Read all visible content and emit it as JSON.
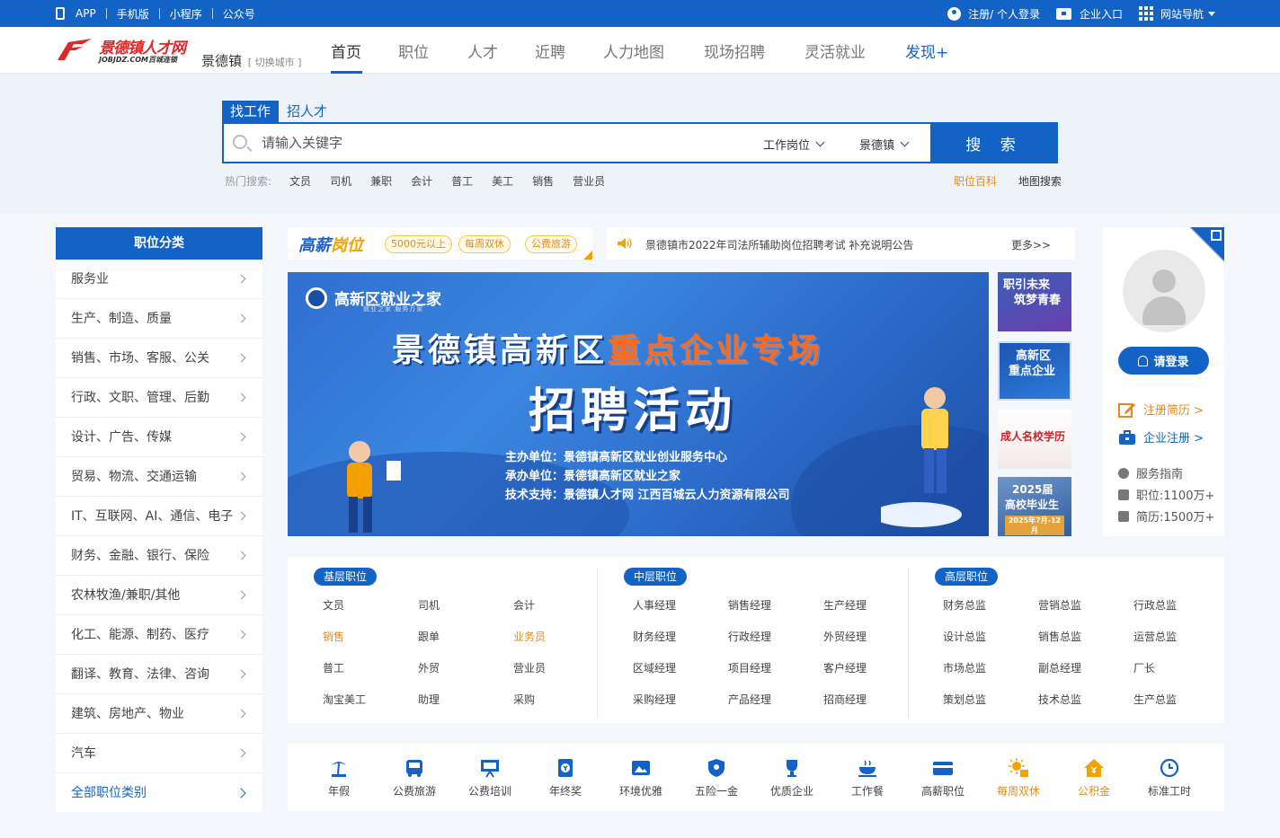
{
  "topbar": {
    "links": [
      "APP",
      "手机版",
      "小程序",
      "公众号"
    ],
    "login": "注册/ 个人登录",
    "enterprise": "企业入口",
    "site_nav": "网站导航"
  },
  "header": {
    "logo_name": "景德镇人才网",
    "logo_domain": "JOBJDZ.COM百城连锁",
    "city": "景德镇",
    "switch_city": "[ 切换城市 ]",
    "nav": [
      "首页",
      "职位",
      "人才",
      "近聘",
      "人力地图",
      "现场招聘",
      "灵活就业",
      "发现+"
    ]
  },
  "search": {
    "tabs": [
      "找工作",
      "招人才"
    ],
    "placeholder": "请输入关键字",
    "dd_position": "工作岗位",
    "dd_city": "景德镇",
    "button": "搜 索",
    "hot_label": "热门搜索:",
    "hot_keywords": [
      "文员",
      "司机",
      "兼职",
      "会计",
      "普工",
      "美工",
      "销售",
      "营业员"
    ],
    "link_baike": "职位百科",
    "link_map": "地图搜索"
  },
  "category": {
    "title": "职位分类",
    "items": [
      "服务业",
      "生产、制造、质量",
      "销售、市场、客服、公关",
      "行政、文职、管理、后勤",
      "设计、广告、传媒",
      "贸易、物流、交通运输",
      "IT、互联网、AI、通信、电子",
      "财务、金融、银行、保险",
      "农林牧渔/兼职/其他",
      "化工、能源、制药、医疗",
      "翻译、教育、法律、咨询",
      "建筑、房地产、物业",
      "汽车"
    ],
    "all": "全部职位类别"
  },
  "promo": {
    "brand_a": "高薪",
    "brand_b": "岗位",
    "tags": [
      "5000元以上",
      "每周双休",
      "公费旅游"
    ]
  },
  "notice": {
    "text": "景德镇市2022年司法所辅助岗位招聘考试 补充说明公告",
    "more": "更多>>"
  },
  "banner": {
    "org": "高新区就业之家",
    "org_sub": "就业之家 服务万家",
    "title_a": "景德镇高新区",
    "title_b": "重点企业专场",
    "title_main": "招聘活动",
    "lines": [
      "主办单位：景德镇高新区就业创业服务中心",
      "承办单位：景德镇高新区就业之家",
      "技术支持：景德镇人才网 江西百城云人力资源有限公司"
    ]
  },
  "thumbs": {
    "t1": [
      "职引未来",
      "筑梦青春"
    ],
    "t2": [
      "高新区",
      "重点企业"
    ],
    "t3": "成人名校学历",
    "t4": [
      "2025届",
      "高校毕业生"
    ],
    "t4_sub": "2025年7月-12月"
  },
  "profile": {
    "login": "请登录",
    "register": "注册简历 >",
    "enterprise": "企业注册 >",
    "guide": "服务指南",
    "jobs": "职位:1100万+",
    "resumes": "简历:1500万+"
  },
  "jobs": {
    "groups": [
      {
        "title": "基层职位",
        "items": [
          "文员",
          "司机",
          "会计",
          "销售",
          "跟单",
          "业务员",
          "普工",
          "外贸",
          "营业员",
          "淘宝美工",
          "助理",
          "采购"
        ]
      },
      {
        "title": "中层职位",
        "items": [
          "人事经理",
          "销售经理",
          "生产经理",
          "财务经理",
          "行政经理",
          "外贸经理",
          "区域经理",
          "项目经理",
          "客户经理",
          "采购经理",
          "产品经理",
          "招商经理"
        ]
      },
      {
        "title": "高层职位",
        "items": [
          "财务总监",
          "营销总监",
          "行政总监",
          "设计总监",
          "销售总监",
          "运营总监",
          "市场总监",
          "副总经理",
          "厂长",
          "策划总监",
          "技术总监",
          "生产总监"
        ]
      }
    ]
  },
  "benefits": [
    "年假",
    "公费旅游",
    "公费培训",
    "年终奖",
    "环境优雅",
    "五险一金",
    "优质企业",
    "工作餐",
    "高薪职位",
    "每周双休",
    "公积金",
    "标准工时"
  ],
  "colors": {
    "primary": "#1363c7",
    "accent": "#e38a1a",
    "logo_red": "#e02828"
  }
}
